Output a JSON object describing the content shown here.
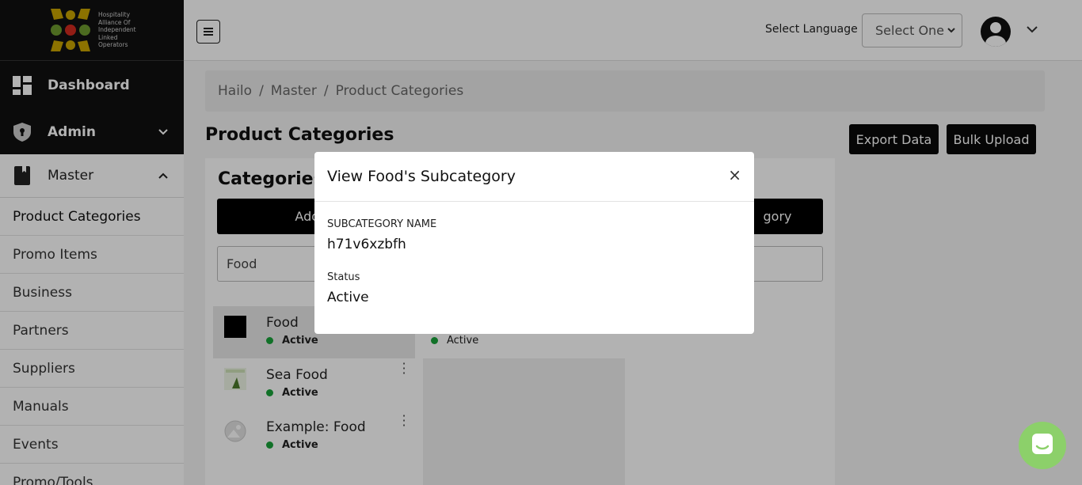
{
  "logo": {
    "text_lines": [
      "Hospitality",
      "Alliance Of",
      "Independent",
      "Linked",
      "Operators"
    ]
  },
  "sidebar": {
    "main_items": [
      {
        "label": "Dashboard",
        "icon": "dashboard-icon"
      },
      {
        "label": "Admin",
        "icon": "shield-icon"
      },
      {
        "label": "Master",
        "icon": "book-icon"
      }
    ],
    "sub_items": [
      {
        "label": "Product Categories"
      },
      {
        "label": "Promo Items"
      },
      {
        "label": "Business"
      },
      {
        "label": "Partners"
      },
      {
        "label": "Suppliers"
      },
      {
        "label": "Manuals"
      },
      {
        "label": "Events"
      },
      {
        "label": "Promo/Tools"
      }
    ]
  },
  "header": {
    "language_label": "Select Language",
    "language_select_value": "Select One"
  },
  "breadcrumb": [
    "Hailo",
    "Master",
    "Product Categories"
  ],
  "page": {
    "title": "Product Categories",
    "export_button": "Export Data",
    "bulk_upload_button": "Bulk Upload"
  },
  "panel": {
    "title": "Categories",
    "add_button_visible": "Add Cate",
    "right_button_visible": "gory",
    "search_value": "Food",
    "categories": [
      {
        "name": "Food",
        "status": "Active",
        "thumb": "black-square"
      },
      {
        "name": "Sea Food",
        "status": "Active",
        "thumb": "food-image"
      },
      {
        "name": "Example: Food",
        "status": "Active",
        "thumb": "placeholder-image"
      }
    ],
    "subcategory_status": "Active"
  },
  "modal": {
    "title": "View Food's Subcategory",
    "close_symbol": "×",
    "fields": [
      {
        "label": "SUBCATEGORY NAME",
        "value": "h71v6xzbfh"
      },
      {
        "label": "Status",
        "value": "Active"
      }
    ]
  },
  "colors": {
    "status_active": "#19a33a",
    "chat_button": "#8cd06a",
    "sidebar_bg": "#111111"
  }
}
